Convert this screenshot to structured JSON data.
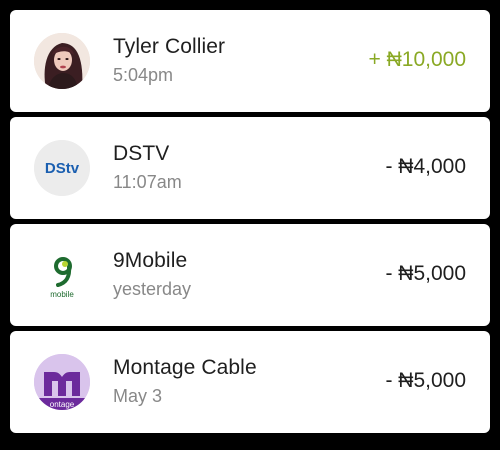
{
  "transactions": [
    {
      "name": "Tyler Collier",
      "time": "5:04pm",
      "amount": "+ ₦10,000",
      "type": "credit",
      "avatar": "person-photo"
    },
    {
      "name": "DSTV",
      "time": "11:07am",
      "amount": "- ₦4,000",
      "type": "debit",
      "avatar": "dstv-logo",
      "logo_text": "DStv"
    },
    {
      "name": "9Mobile",
      "time": "yesterday",
      "amount": "- ₦5,000",
      "type": "debit",
      "avatar": "9mobile-logo",
      "logo_text": "mobile"
    },
    {
      "name": "Montage Cable",
      "time": "May 3",
      "amount": "- ₦5,000",
      "type": "debit",
      "avatar": "montage-logo",
      "logo_text": "ontage"
    }
  ],
  "colors": {
    "credit": "#8aa925",
    "debit": "#1f1f1f",
    "secondary_text": "#888888",
    "background": "#000000",
    "card": "#ffffff"
  }
}
